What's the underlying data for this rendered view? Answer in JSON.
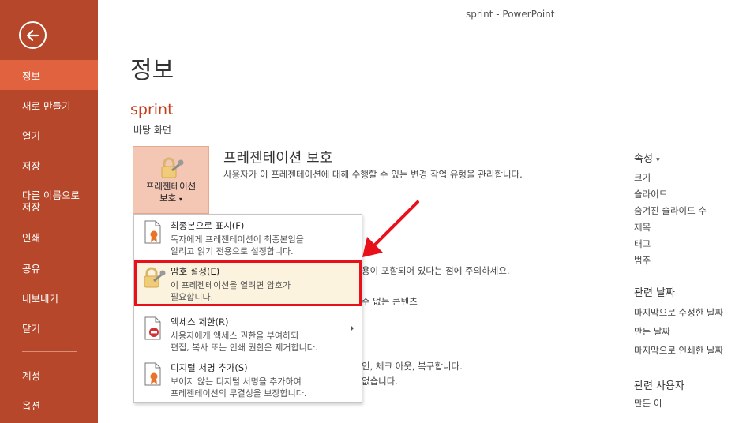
{
  "window": {
    "title": "sprint - PowerPoint"
  },
  "nav": {
    "back_label": "",
    "items": [
      {
        "label": "정보",
        "active": true
      },
      {
        "label": "새로 만들기"
      },
      {
        "label": "열기"
      },
      {
        "label": "저장"
      },
      {
        "label": "다른 이름으로",
        "label2": "저장"
      },
      {
        "label": "인쇄"
      },
      {
        "label": "공유"
      },
      {
        "label": "내보내기"
      },
      {
        "label": "닫기"
      },
      {
        "label": "계정"
      },
      {
        "label": "옵션"
      }
    ]
  },
  "main": {
    "title": "정보",
    "file_name": "sprint",
    "file_location": "바탕 화면",
    "protect": {
      "button_line1": "프레젠테이션",
      "button_line2": "보호",
      "heading": "프레젠테이션 보호",
      "description": "사용자가 이 프레젠테이션에 대해 수행할 수 있는 변경 작업 유형을 관리합니다."
    },
    "partial_text": {
      "line1": "용이 포함되어 있다는 점에 주의하세요.",
      "line2": "수 없는 콘텐츠",
      "line3": "인, 체크 아웃, 복구합니다.",
      "line4": "없습니다."
    }
  },
  "menu": {
    "items": [
      {
        "title": "최종본으로 표시(F)",
        "desc1": "독자에게 프레젠테이션이 최종본임을",
        "desc2": "알리고 읽기 전용으로 설정합니다."
      },
      {
        "title": "암호 설정(E)",
        "desc1": "이 프레젠테이션을 열려면 암호가",
        "desc2": "필요합니다.",
        "highlighted": true
      },
      {
        "title": "액세스 제한(R)",
        "desc1": "사용자에게 액세스 권한을 부여하되",
        "desc2": "편집, 복사 또는 인쇄 권한은 제거합니다.",
        "has_submenu": true
      },
      {
        "title": "디지털 서명 추가(S)",
        "desc1": "보이지 않는 디지털 서명을 추가하여",
        "desc2": "프레젠테이션의 무결성을 보장합니다."
      }
    ]
  },
  "properties": {
    "heading": "속성",
    "rows": [
      "크기",
      "슬라이드",
      "숨겨진 슬라이드 수",
      "제목",
      "태그",
      "범주"
    ],
    "dates_heading": "관련 날짜",
    "dates": [
      "마지막으로 수정한 날짜",
      "만든 날짜",
      "마지막으로 인쇄한 날짜"
    ],
    "people_heading": "관련 사용자",
    "people": [
      "만든 이"
    ]
  },
  "colors": {
    "nav_bg": "#b7472a",
    "nav_active": "#e0623f",
    "accent_text": "#c43e1c",
    "highlight_border": "#e8101a"
  }
}
